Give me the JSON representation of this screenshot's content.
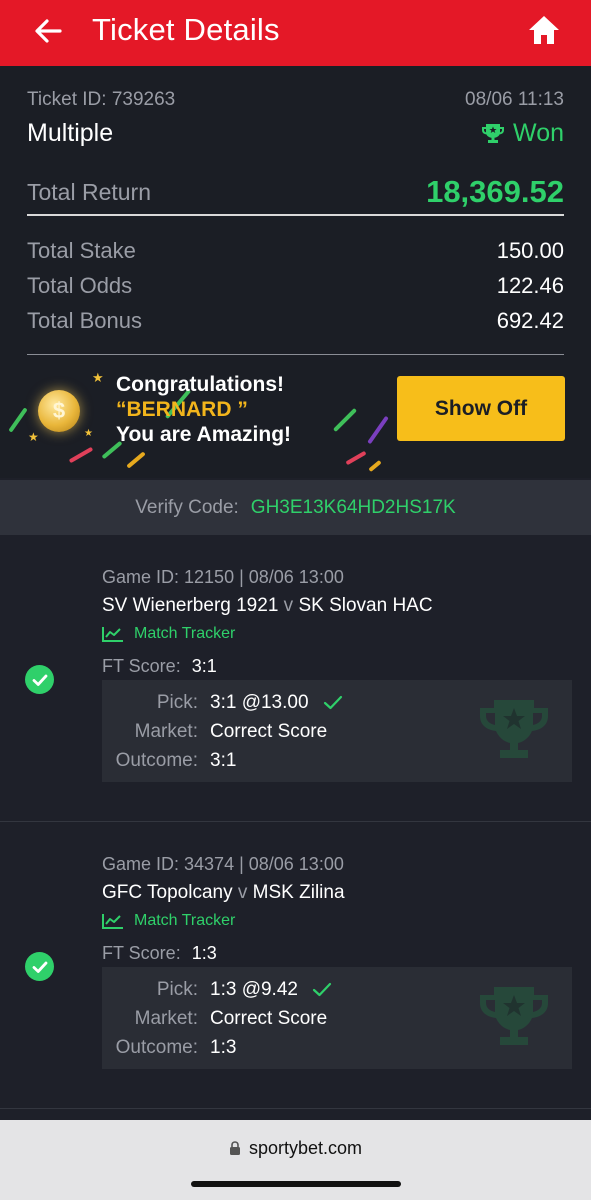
{
  "header": {
    "title": "Ticket Details",
    "back_icon": "arrow-left-icon",
    "home_icon": "home-icon",
    "bg_color": "#e41827"
  },
  "ticket": {
    "id_label": "Ticket ID:",
    "id": "739263",
    "datetime": "08/06 11:13",
    "type": "Multiple",
    "status": "Won",
    "return_label": "Total Return",
    "return_value": "18,369.52",
    "stake_label": "Total Stake",
    "stake_value": "150.00",
    "odds_label": "Total Odds",
    "odds_value": "122.46",
    "bonus_label": "Total Bonus",
    "bonus_value": "692.42"
  },
  "banner": {
    "line1": "Congratulations!",
    "line2": "“BERNARD ”",
    "line3": "You are Amazing!",
    "button": "Show Off"
  },
  "verify": {
    "label": "Verify Code:",
    "code": "GH3E13K64HD2HS17K"
  },
  "games": [
    {
      "id_line": "Game ID: 12150 | 08/06 13:00",
      "home": "SV Wienerberg 1921",
      "vs": "v",
      "away": "SK Slovan HAC",
      "tracker": "Match Tracker",
      "ft_label": "FT Score:",
      "ft_value": "3:1",
      "pick_label": "Pick:",
      "pick_value": "3:1 @13.00",
      "market_label": "Market:",
      "market_value": "Correct Score",
      "outcome_label": "Outcome:",
      "outcome_value": "3:1"
    },
    {
      "id_line": "Game ID: 34374 | 08/06 13:00",
      "home": "GFC Topolcany",
      "vs": "v",
      "away": "MSK Zilina",
      "tracker": "Match Tracker",
      "ft_label": "FT Score:",
      "ft_value": "1:3",
      "pick_label": "Pick:",
      "pick_value": "1:3 @9.42",
      "market_label": "Market:",
      "market_value": "Correct Score",
      "outcome_label": "Outcome:",
      "outcome_value": "1:3"
    }
  ],
  "browser": {
    "url": "sportybet.com"
  },
  "colors": {
    "accent_green": "#2fd06a",
    "button_yellow": "#f7be1a",
    "brand_red": "#e41827"
  }
}
